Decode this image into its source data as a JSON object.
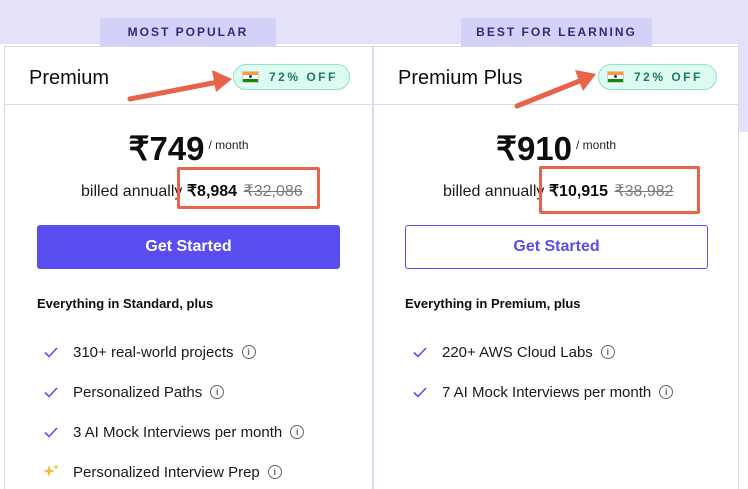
{
  "ribbons": {
    "premium": "MOST POPULAR",
    "premium_plus": "BEST FOR LEARNING"
  },
  "plans": [
    {
      "name": "Premium",
      "discount": "72% OFF",
      "price": "₹749",
      "per": "/ month",
      "billed_label": "billed annually",
      "billed_price": "₹8,984",
      "original_price": "₹32,086",
      "cta": "Get Started",
      "features_heading": "Everything in Standard, plus",
      "features": [
        {
          "text": "310+ real-world projects",
          "icon": "check-icon"
        },
        {
          "text": "Personalized Paths",
          "icon": "check-icon"
        },
        {
          "text": "3 AI Mock Interviews per month",
          "icon": "check-icon"
        },
        {
          "text": "Personalized Interview Prep",
          "icon": "sparkle-icon"
        }
      ]
    },
    {
      "name": "Premium Plus",
      "discount": "72% OFF",
      "price": "₹910",
      "per": "/ month",
      "billed_label": "billed annually",
      "billed_price": "₹10,915",
      "original_price": "₹38,982",
      "cta": "Get Started",
      "features_heading": "Everything in Premium, plus",
      "features": [
        {
          "text": "220+ AWS Cloud Labs",
          "icon": "check-icon"
        },
        {
          "text": "7 AI Mock Interviews per month",
          "icon": "check-icon"
        }
      ]
    }
  ],
  "colors": {
    "accent": "#5b4ef0",
    "annotation": "#e8634a",
    "discount_bg": "#ddfbf1",
    "band": "#e4e2fb"
  }
}
